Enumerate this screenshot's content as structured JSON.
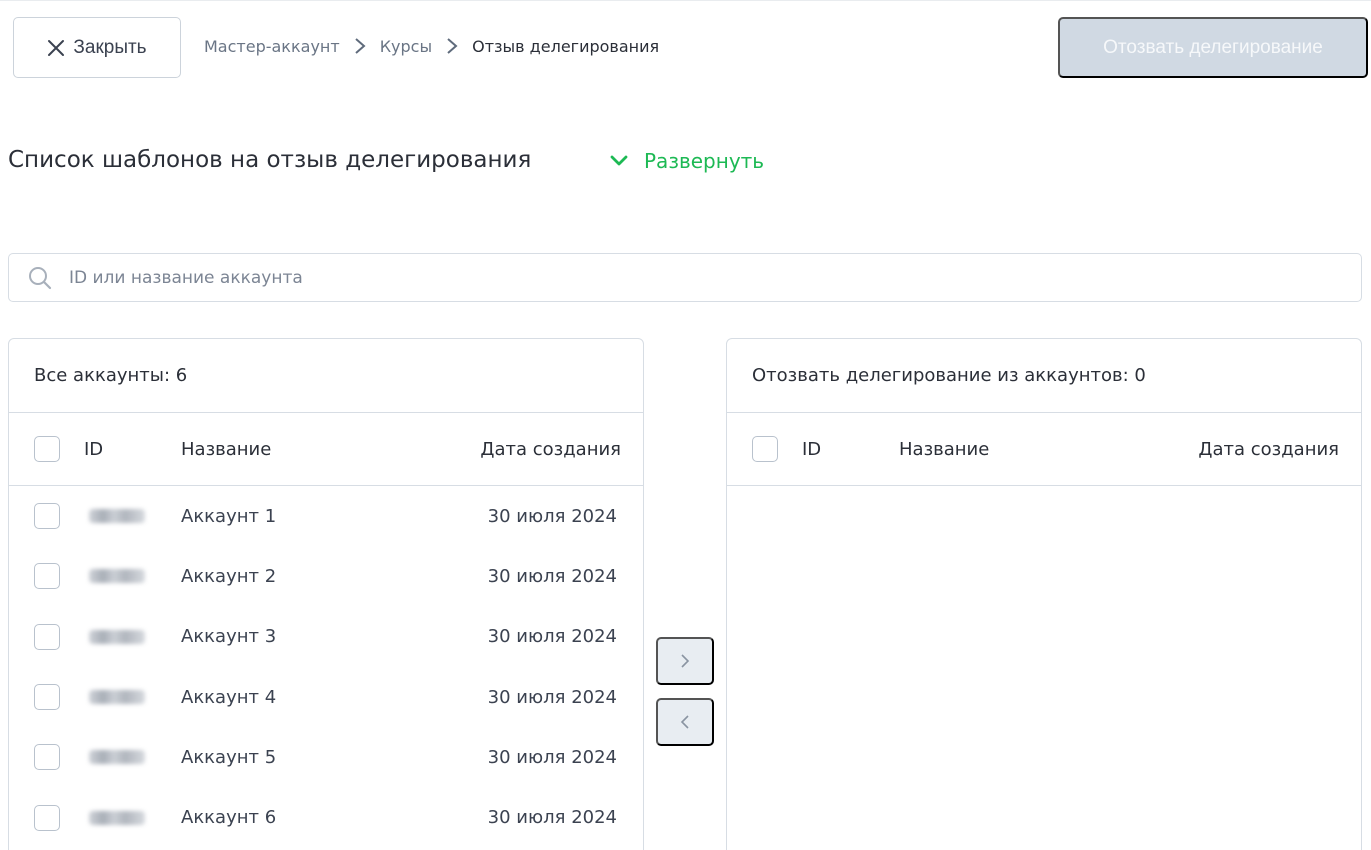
{
  "header": {
    "close_label": "Закрыть",
    "breadcrumb": [
      "Мастер-аккаунт",
      "Курсы",
      "Отзыв делегирования"
    ],
    "revoke_label": "Отозвать делегирование"
  },
  "section": {
    "title": "Список шаблонов на отзыв делегирования",
    "expand_label": "Развернуть"
  },
  "search": {
    "placeholder": "ID или название аккаунта",
    "value": ""
  },
  "left_panel": {
    "title": "Все аккаунты: 6",
    "columns": {
      "id": "ID",
      "name": "Название",
      "date": "Дата создания"
    },
    "rows": [
      {
        "name": "Аккаунт 1",
        "date": "30 июля 2024"
      },
      {
        "name": "Аккаунт 2",
        "date": "30 июля 2024"
      },
      {
        "name": "Аккаунт 3",
        "date": "30 июля 2024"
      },
      {
        "name": "Аккаунт 4",
        "date": "30 июля 2024"
      },
      {
        "name": "Аккаунт 5",
        "date": "30 июля 2024"
      },
      {
        "name": "Аккаунт 6",
        "date": "30 июля 2024"
      }
    ]
  },
  "right_panel": {
    "title": "Отозвать делегирование из аккаунтов: 0",
    "columns": {
      "id": "ID",
      "name": "Название",
      "date": "Дата создания"
    },
    "rows": []
  },
  "transfer": {
    "move_right_icon": "chevron-right-icon",
    "move_left_icon": "chevron-left-icon"
  },
  "colors": {
    "accent_green": "#1db954",
    "disabled_button": "#d0d9e3",
    "border": "#d7dde4"
  }
}
